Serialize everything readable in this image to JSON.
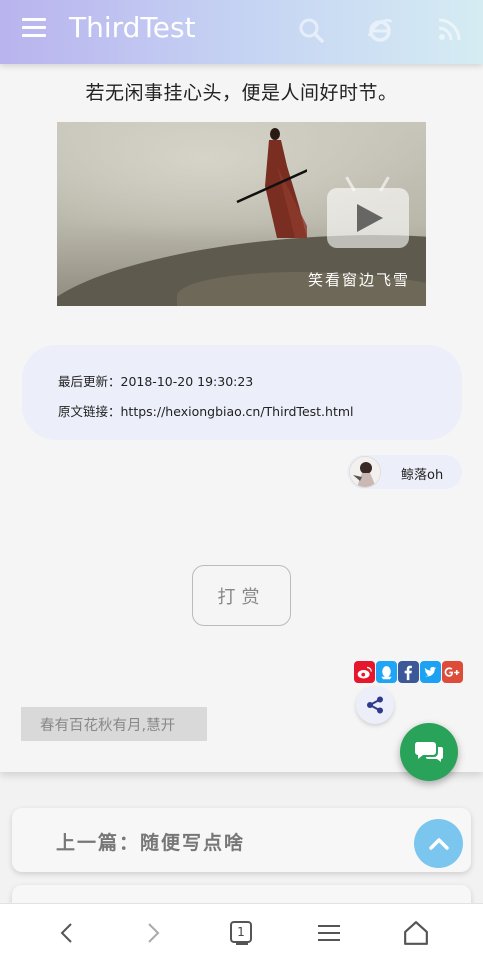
{
  "header": {
    "title": "ThirdTest",
    "icons": [
      "menu-icon",
      "search-icon",
      "ie-browser-icon",
      "rss-icon"
    ]
  },
  "article": {
    "quote": "若无闲事挂心头，便是人间好时节。",
    "video": {
      "watermark": "笑看窗边飞雪",
      "play_icon": "video-play-icon"
    },
    "meta": {
      "updated": "最后更新：2018-10-20 19:30:23",
      "link": "原文链接：https://hexiongbiao.cn/ThirdTest.html"
    },
    "author": {
      "name": "鲸落oh"
    },
    "reward_label": "打赏",
    "share": {
      "targets": [
        {
          "icon": "weibo-icon",
          "color": "#e6162d"
        },
        {
          "icon": "qq-icon",
          "color": "#1fa5f6"
        },
        {
          "icon": "facebook-icon",
          "color": "#3b5998",
          "glyph": "f"
        },
        {
          "icon": "twitter-icon",
          "color": "#1da1f2"
        },
        {
          "icon": "google-plus-icon",
          "color": "#dd4b39",
          "glyph": "G+"
        }
      ]
    },
    "tag": "春有百花秋有月,慧开"
  },
  "navigation": {
    "prev": "上一篇：随便写点啥"
  },
  "browser_nav": {
    "tab_count": "1",
    "icons": [
      "back-icon",
      "forward-icon",
      "tabs-icon",
      "menu-icon",
      "home-icon"
    ]
  },
  "colors": {
    "header_gradient_start": "#b9b3ee",
    "header_gradient_end": "#d5ecf3",
    "meta_bg": "#eceef9",
    "chat_fab": "#2aa35a",
    "up_fab": "#7ac6ef"
  }
}
